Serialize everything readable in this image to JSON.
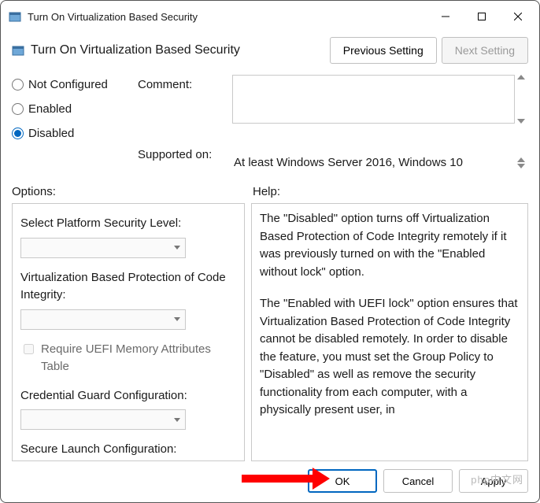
{
  "window": {
    "title": "Turn On Virtualization Based Security"
  },
  "header": {
    "label": "Turn On Virtualization Based Security",
    "prev": "Previous Setting",
    "next": "Next Setting"
  },
  "state": {
    "not_configured": "Not Configured",
    "enabled": "Enabled",
    "disabled": "Disabled",
    "selected": "disabled"
  },
  "fields": {
    "comment_label": "Comment:",
    "comment_value": "",
    "supported_label": "Supported on:",
    "supported_value": "At least Windows Server 2016, Windows 10"
  },
  "panes": {
    "options_label": "Options:",
    "help_label": "Help:"
  },
  "options": {
    "platform_level": "Select Platform Security Level:",
    "vbp_integrity": "Virtualization Based Protection of Code Integrity:",
    "require_uefi": "Require UEFI Memory Attributes Table",
    "credential_guard": "Credential Guard Configuration:",
    "secure_launch": "Secure Launch Configuration:"
  },
  "help": {
    "p1": "The \"Disabled\" option turns off Virtualization Based Protection of Code Integrity remotely if it was previously turned on with the \"Enabled without lock\" option.",
    "p2": "The \"Enabled with UEFI lock\" option ensures that Virtualization Based Protection of Code Integrity cannot be disabled remotely. In order to disable the feature, you must set the Group Policy to \"Disabled\" as well as remove the security functionality from each computer, with a physically present user, in"
  },
  "footer": {
    "ok": "OK",
    "cancel": "Cancel",
    "apply": "Apply"
  },
  "watermark": "php中文网"
}
